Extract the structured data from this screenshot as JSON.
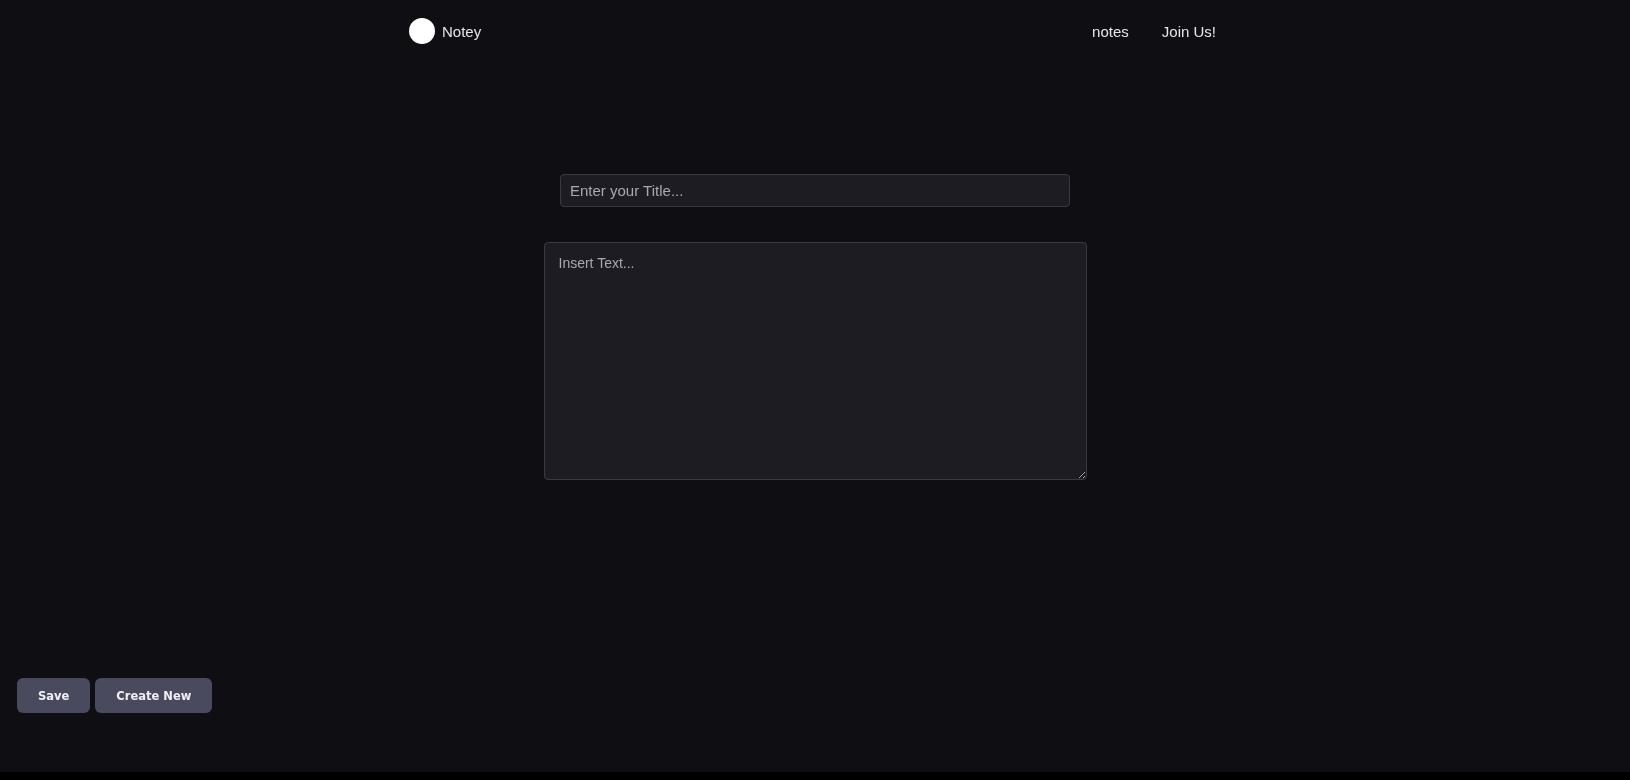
{
  "header": {
    "brand": "Notey",
    "nav": [
      "notes",
      "Join Us!"
    ]
  },
  "title_field": {
    "placeholder": "Enter your Title..."
  },
  "text_area": {
    "placeholder": "Insert Text..."
  },
  "buttons": [
    "Save",
    "Create New"
  ]
}
